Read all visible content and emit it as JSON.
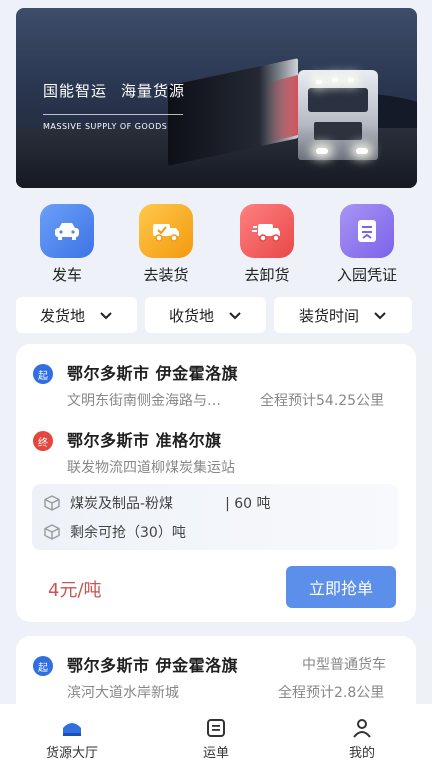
{
  "banner": {
    "slogan_1": "国能智运",
    "slogan_2": "海量货源",
    "subtitle": "MASSIVE SUPPLY OF GOODS"
  },
  "quick_actions": [
    {
      "label": "发车",
      "icon": "car-icon",
      "color": "#4f86f0"
    },
    {
      "label": "去装货",
      "icon": "truck-loading-icon",
      "color": "#f7a91c"
    },
    {
      "label": "去卸货",
      "icon": "truck-unloading-icon",
      "color": "#ee5b5b"
    },
    {
      "label": "入园凭证",
      "icon": "document-icon",
      "color": "#8a74ee"
    }
  ],
  "filters": [
    {
      "label": "发货地"
    },
    {
      "label": "收货地"
    },
    {
      "label": "装货时间"
    }
  ],
  "orders": [
    {
      "start_badge": "起",
      "start_city": "鄂尔多斯市 伊金霍洛旗",
      "start_addr": "文明东街南侧金海路与…",
      "distance": "全程预计54.25公里",
      "end_badge": "终",
      "end_city": "鄂尔多斯市 准格尔旗",
      "end_addr": "联发物流四道柳煤炭集运站",
      "goods": "煤炭及制品-粉煤",
      "weight": "| 60 吨",
      "remaining": "剩余可抢（30）吨",
      "price": "4元/吨",
      "grab_label": "立即抢单"
    },
    {
      "start_badge": "起",
      "start_city": "鄂尔多斯市 伊金霍洛旗",
      "vehicle": "中型普通货车",
      "start_addr": "滨河大道水岸新城",
      "distance": "全程预计2.8公里"
    }
  ],
  "tabbar": [
    {
      "label": "货源大厅",
      "icon": "home-icon",
      "active": true
    },
    {
      "label": "运单",
      "icon": "list-icon",
      "active": false
    },
    {
      "label": "我的",
      "icon": "user-icon",
      "active": false
    }
  ],
  "colors": {
    "accent": "#2f6fe0",
    "price": "#c65555",
    "button": "#5b8fe9"
  }
}
